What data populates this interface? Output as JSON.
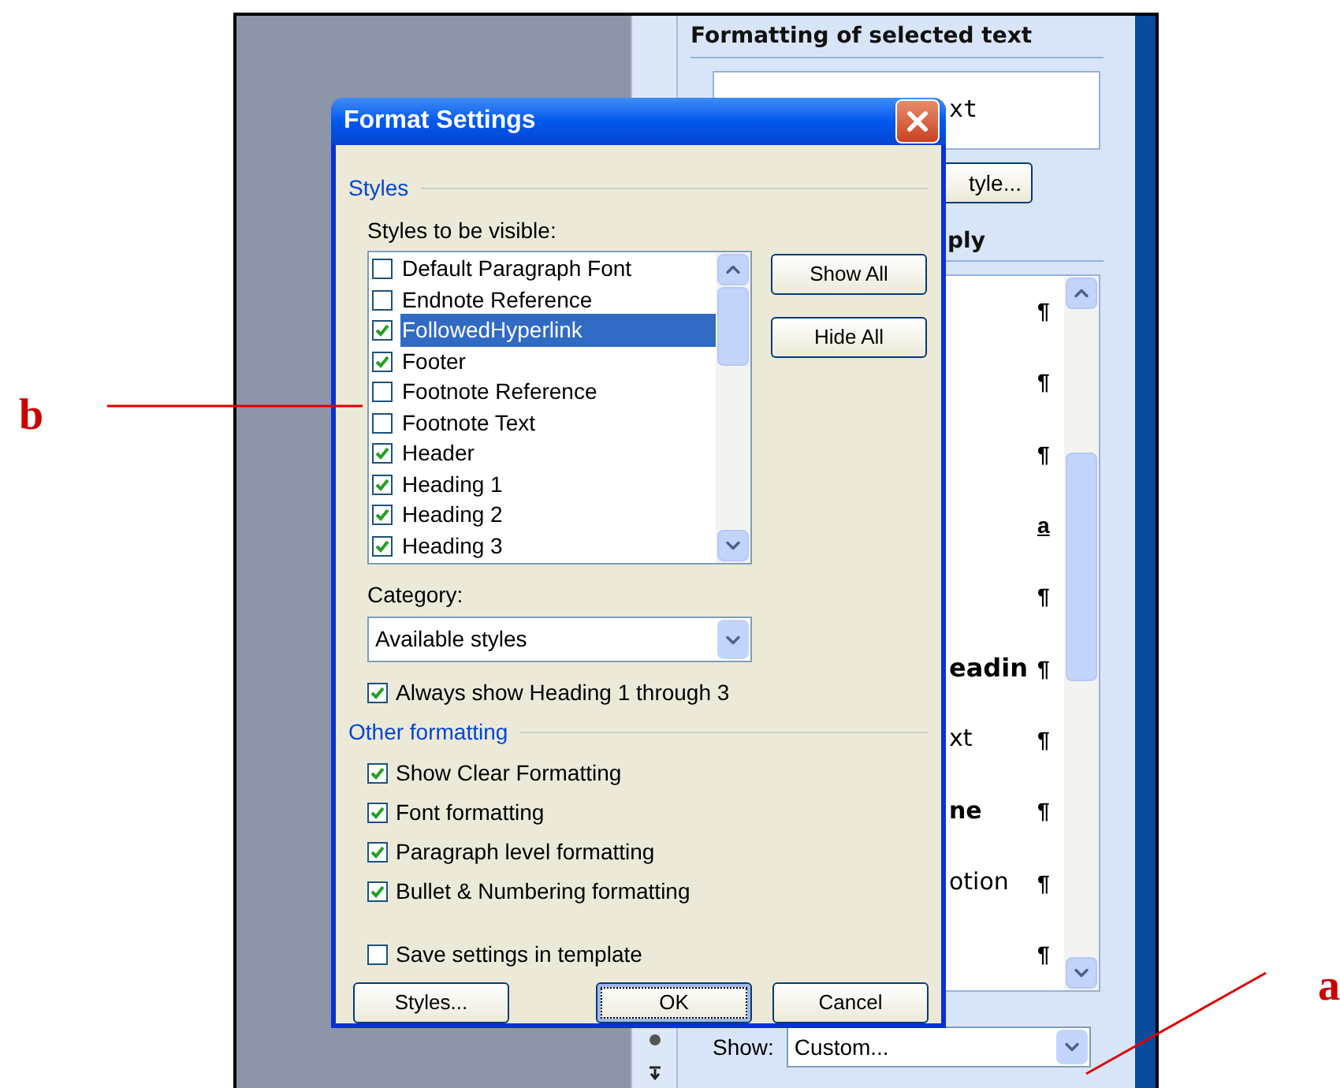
{
  "annotations": [
    {
      "label": "b",
      "kind": "left"
    },
    {
      "label": "a",
      "kind": "right"
    }
  ],
  "task_pane": {
    "heading": "Formatting of selected text",
    "preview_fragment": "xt",
    "style_button": "tyle...",
    "list_heading": "ply",
    "items": [
      {
        "kind": "paragraph",
        "mark": "¶"
      },
      {
        "kind": "paragraph",
        "mark": "¶"
      },
      {
        "kind": "paragraph",
        "mark": "¶"
      },
      {
        "kind": "character",
        "mark": "a"
      },
      {
        "kind": "paragraph",
        "mark": "¶"
      },
      {
        "kind": "paragraph",
        "fragment": "eadin",
        "bold": true,
        "large": true,
        "mark": "¶"
      },
      {
        "kind": "paragraph",
        "fragment": "xt",
        "bold": false,
        "large": false,
        "mark": "¶"
      },
      {
        "kind": "paragraph",
        "fragment": "ne",
        "bold": true,
        "large": false,
        "mark": "¶"
      },
      {
        "kind": "paragraph",
        "fragment": "otion",
        "bold": false,
        "large": false,
        "mark": "¶"
      },
      {
        "kind": "paragraph",
        "mark": "¶"
      }
    ],
    "show_label": "Show:",
    "show_value": "Custom..."
  },
  "dialog": {
    "title": "Format Settings",
    "styles_group": "Styles",
    "list_label": "Styles to be visible:",
    "styles": [
      {
        "label": "Default Paragraph Font",
        "checked": false,
        "selected": false
      },
      {
        "label": "Endnote Reference",
        "checked": false,
        "selected": false
      },
      {
        "label": "FollowedHyperlink",
        "checked": true,
        "selected": true
      },
      {
        "label": "Footer",
        "checked": true,
        "selected": false
      },
      {
        "label": "Footnote Reference",
        "checked": false,
        "selected": false
      },
      {
        "label": "Footnote Text",
        "checked": false,
        "selected": false
      },
      {
        "label": "Header",
        "checked": true,
        "selected": false
      },
      {
        "label": "Heading 1",
        "checked": true,
        "selected": false
      },
      {
        "label": "Heading 2",
        "checked": true,
        "selected": false
      },
      {
        "label": "Heading 3",
        "checked": true,
        "selected": false
      }
    ],
    "side_buttons": [
      "Show All",
      "Hide All"
    ],
    "category_label": "Category:",
    "category_value": "Available styles",
    "always_heading": {
      "label": "Always show Heading 1 through 3",
      "checked": true
    },
    "other_group": "Other formatting",
    "options": [
      {
        "label": "Show Clear Formatting",
        "checked": true
      },
      {
        "label": "Font formatting",
        "checked": true
      },
      {
        "label": "Paragraph level formatting",
        "checked": true
      },
      {
        "label": "Bullet & Numbering formatting",
        "checked": true
      }
    ],
    "save_template": {
      "label": "Save settings in template",
      "checked": false
    },
    "buttons": [
      {
        "label": "Styles...",
        "default": false
      },
      {
        "label": "OK",
        "default": true
      },
      {
        "label": "Cancel",
        "default": false
      }
    ]
  }
}
